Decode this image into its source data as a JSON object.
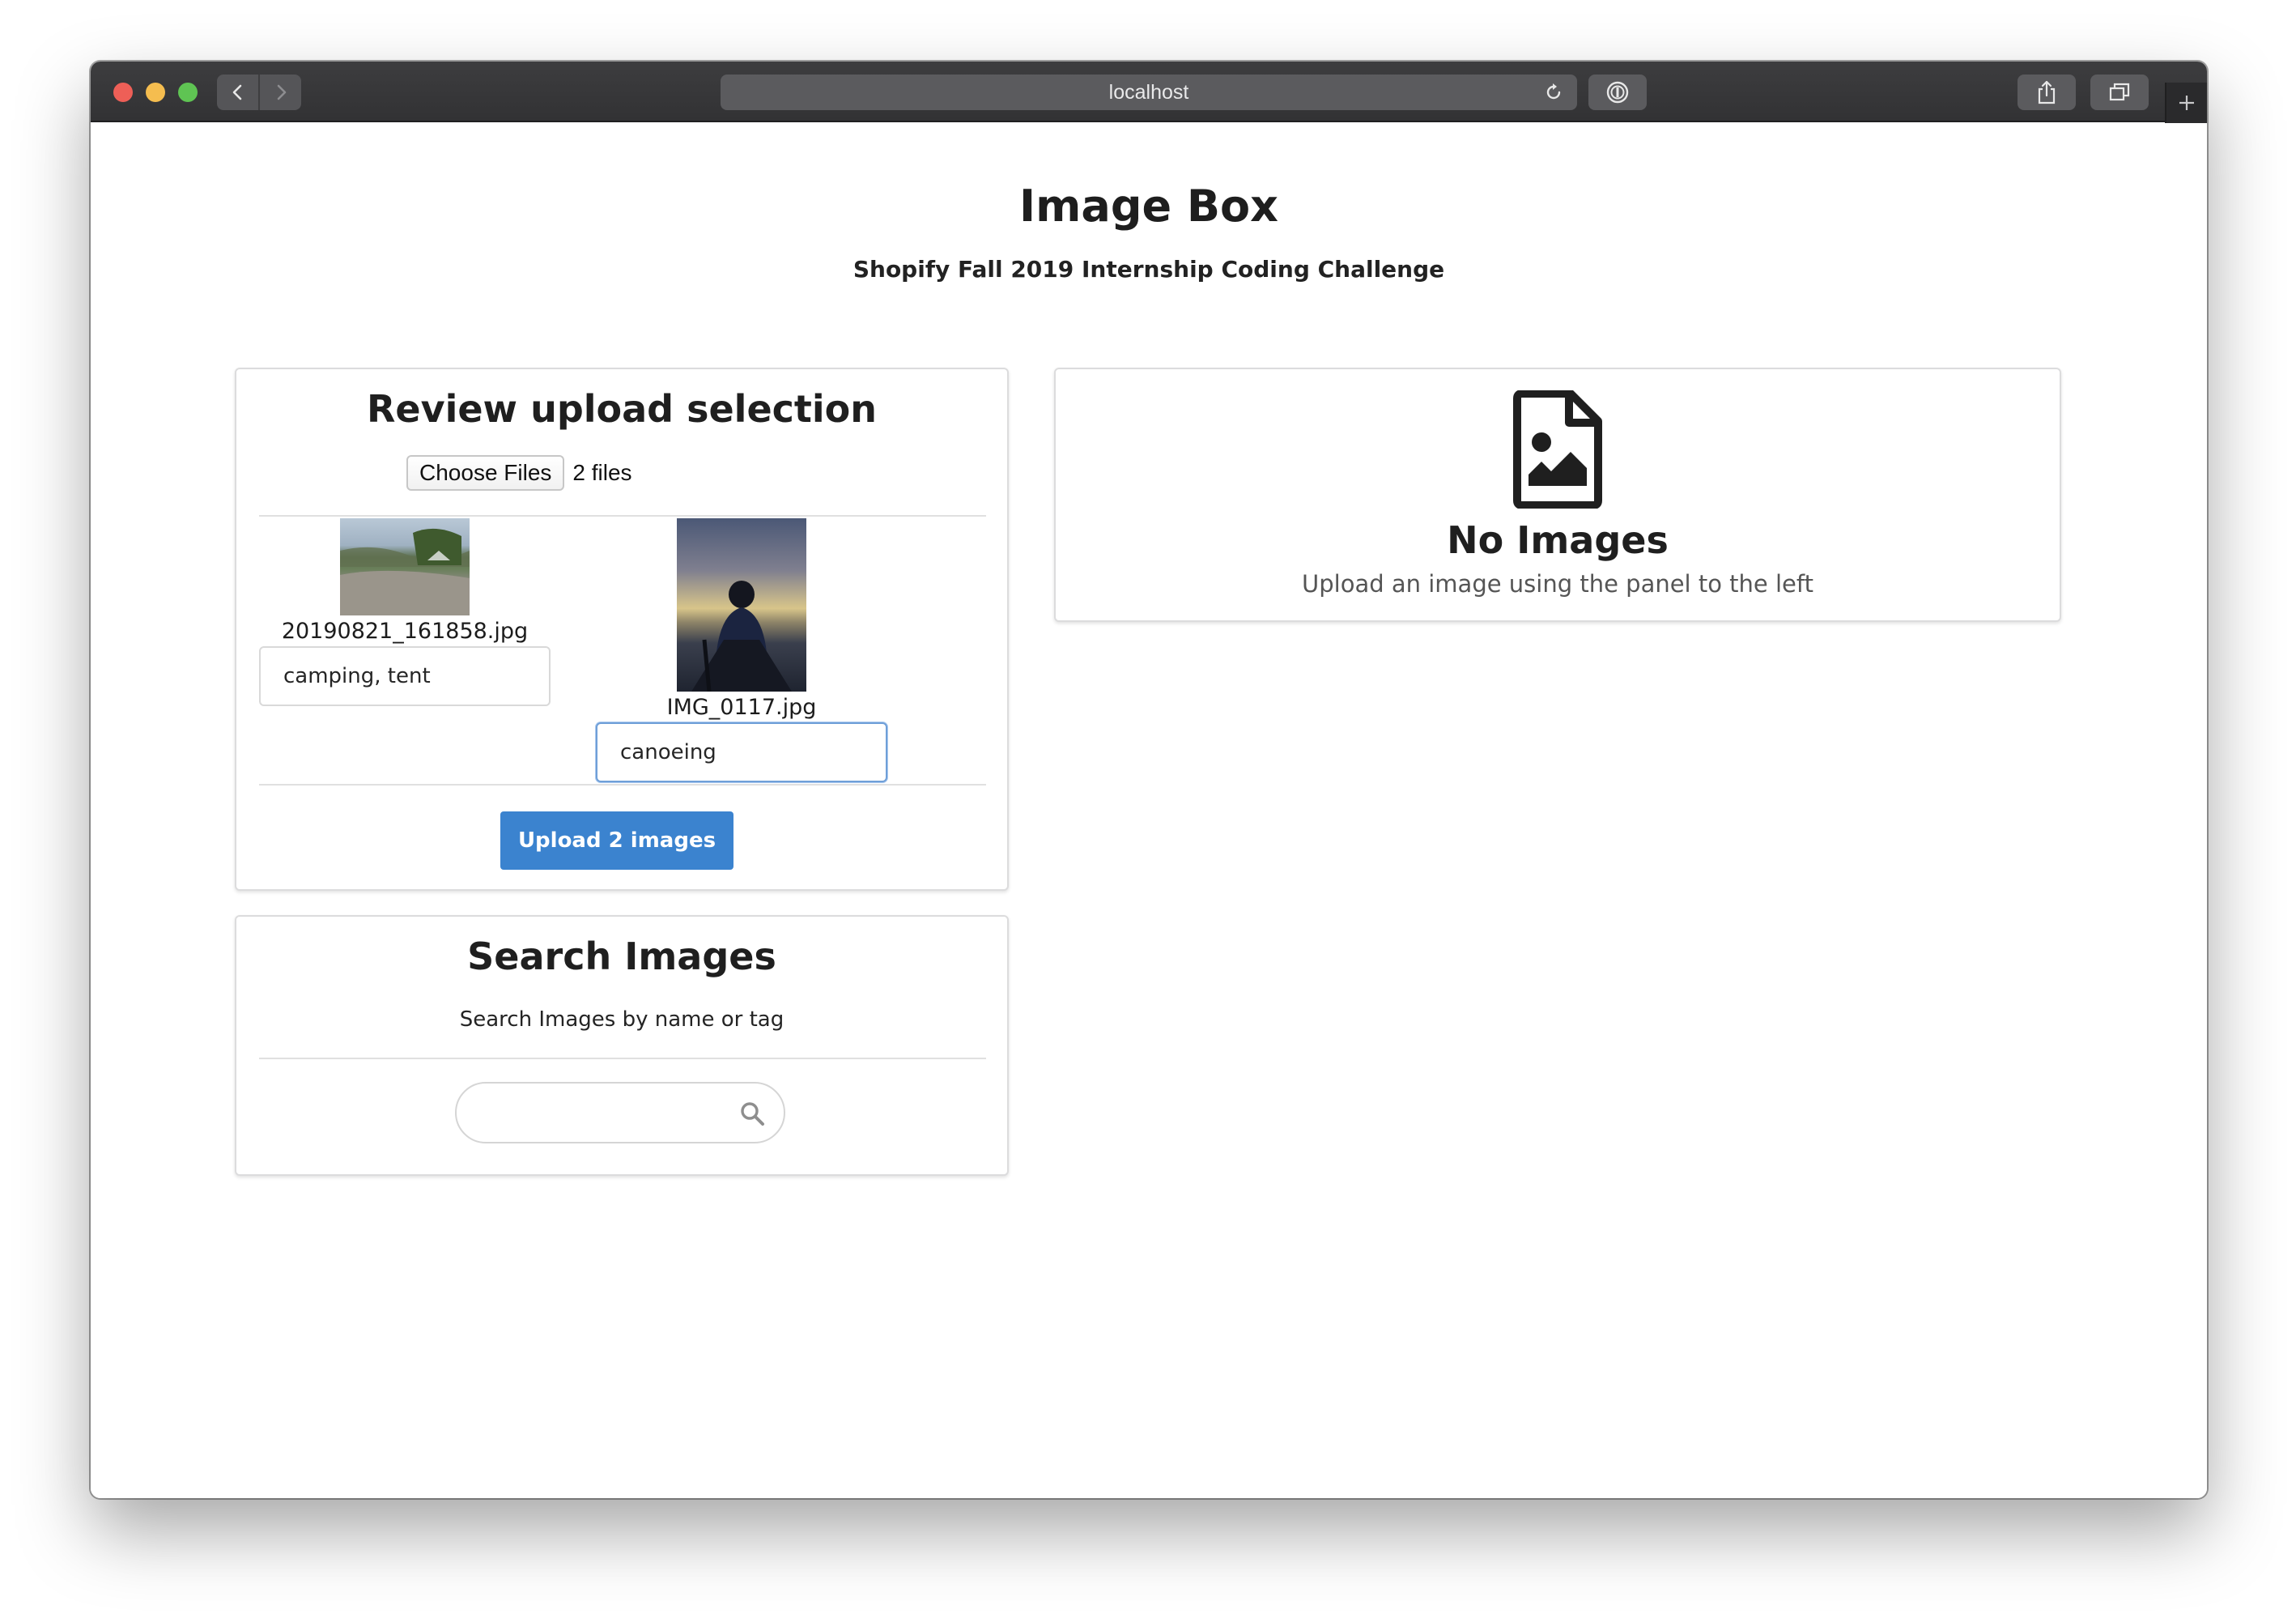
{
  "browser": {
    "url": "localhost"
  },
  "page": {
    "title": "Image Box",
    "subtitle": "Shopify Fall 2019 Internship Coding Challenge"
  },
  "upload_panel": {
    "heading": "Review upload selection",
    "choose_files_label": "Choose Files",
    "files_count_text": "2 files",
    "items": [
      {
        "filename": "20190821_161858.jpg",
        "tags": "camping, tent"
      },
      {
        "filename": "IMG_0117.jpg",
        "tags": "canoeing"
      }
    ],
    "upload_button_label": "Upload 2 images"
  },
  "search_panel": {
    "heading": "Search Images",
    "description": "Search Images by name or tag",
    "query": ""
  },
  "gallery": {
    "empty_title": "No Images",
    "empty_description": "Upload an image using the panel to the left",
    "icon": "file-image-icon"
  },
  "colors": {
    "primary_button": "#3b83cf",
    "focus_border": "#6f9fd8"
  }
}
